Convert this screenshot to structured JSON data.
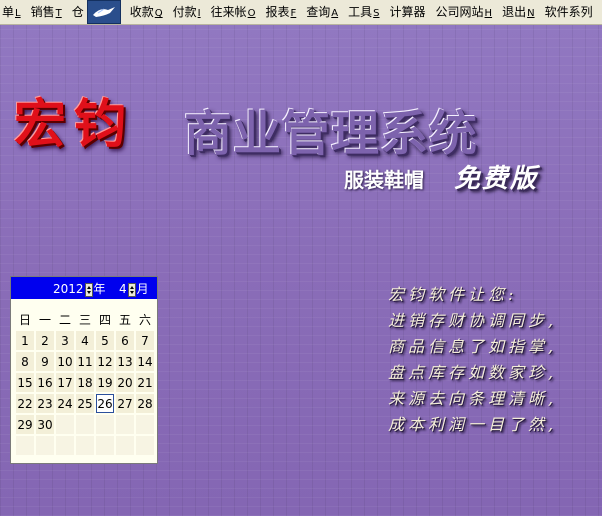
{
  "menu": {
    "items": [
      {
        "label": "单",
        "accel": "L"
      },
      {
        "label": "销售",
        "accel": "T"
      },
      {
        "label": "仓",
        "accel": ""
      },
      {
        "label": "",
        "accel": ""
      },
      {
        "label": "收款",
        "accel": "Q"
      },
      {
        "label": "付款",
        "accel": "I"
      },
      {
        "label": "往来帐",
        "accel": "O"
      },
      {
        "label": "报表",
        "accel": "F"
      },
      {
        "label": "查询",
        "accel": "A"
      },
      {
        "label": "工具",
        "accel": "S"
      },
      {
        "label": "计算器",
        "accel": ""
      },
      {
        "label": "公司网站",
        "accel": "H"
      },
      {
        "label": "退出",
        "accel": "N"
      },
      {
        "label": "软件系列",
        "accel": ""
      }
    ]
  },
  "branding": {
    "logo": "宏钧",
    "title": "商业管理系统",
    "subtitle": "服装鞋帽",
    "edition": "免费版"
  },
  "calendar": {
    "year": "2012",
    "year_label": "年",
    "month": "4",
    "month_label": "月",
    "weekdays": [
      "日",
      "一",
      "二",
      "三",
      "四",
      "五",
      "六"
    ],
    "weeks": [
      [
        "1",
        "2",
        "3",
        "4",
        "5",
        "6",
        "7"
      ],
      [
        "8",
        "9",
        "10",
        "11",
        "12",
        "13",
        "14"
      ],
      [
        "15",
        "16",
        "17",
        "18",
        "19",
        "20",
        "21"
      ],
      [
        "22",
        "23",
        "24",
        "25",
        "26",
        "27",
        "28"
      ],
      [
        "29",
        "30",
        "",
        "",
        "",
        "",
        ""
      ],
      [
        "",
        "",
        "",
        "",
        "",
        "",
        ""
      ]
    ],
    "today": "26"
  },
  "poem": {
    "lines": [
      "宏钧软件让您:",
      "进销存财协调同步,",
      "商品信息了如指掌,",
      "盘点库存如数家珍,",
      "来源去向条理清晰,",
      "成本利润一目了然,"
    ]
  },
  "colors": {
    "background": "#8c6fba",
    "logo_red": "#e0101a",
    "calendar_header": "#0000ee"
  }
}
